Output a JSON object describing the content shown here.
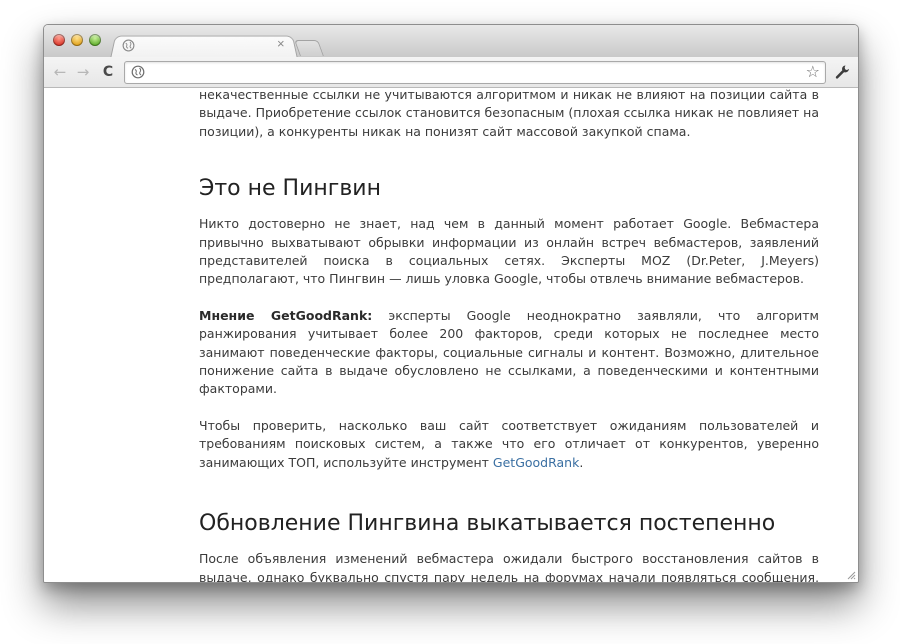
{
  "browser": {
    "tab": {
      "title": "",
      "favicon": "globe-icon",
      "close_label": "×"
    },
    "toolbar": {
      "back_icon": "←",
      "forward_icon": "→",
      "reload_icon": "C",
      "address_value": "",
      "star_icon": "☆",
      "wrench_icon": "🔧"
    }
  },
  "article": {
    "intro_paragraph": "некачественные ссылки не учитываются алгоритмом и никак не влияют на позиции сайта в выдаче. Приобретение ссылок становится безопасным (плохая ссылка никак не повлияет на позиции), а конкуренты никак на понизят сайт массовой закупкой спама.",
    "section1": {
      "heading": "Это не Пингвин",
      "paragraph1": "Никто достоверно не знает, над чем в данный момент работает Google. Вебмастера привычно выхватывают обрывки информации из онлайн встреч вебмастеров, заявлений представителей поиска в социальных сетях. Эксперты MOZ (Dr.Peter, J.Meyers) предполагают, что Пингвин — лишь уловка Google, чтобы отвлечь внимание вебмастеров.",
      "opinion_label": "Мнение GetGoodRank:",
      "opinion_text": " эксперты Google неоднократно заявляли, что алгоритм ранжирования учитывает более 200 факторов, среди которых не последнее место занимают поведенческие факторы, социальные сигналы и контент. Возможно, длительное понижение сайта в выдаче обусловлено не ссылками, а поведенческими и контентными факторами.",
      "paragraph3_text": "Чтобы проверить, насколько ваш сайт соответствует ожиданиям пользователей и требованиям поисковых систем, а также что его отличает от конкурентов, уверенно занимающих ТОП, используйте инструмент ",
      "paragraph3_link": "GetGoodRank",
      "paragraph3_end": "."
    },
    "section2": {
      "heading": "Обновление Пингвина выкатывается постепенно",
      "paragraph1": "После объявления изменений вебмастера ожидали быстрого восстановления сайтов в выдаче, однако буквально спустя пару недель на форумах начали появляться сообщения, что"
    }
  }
}
